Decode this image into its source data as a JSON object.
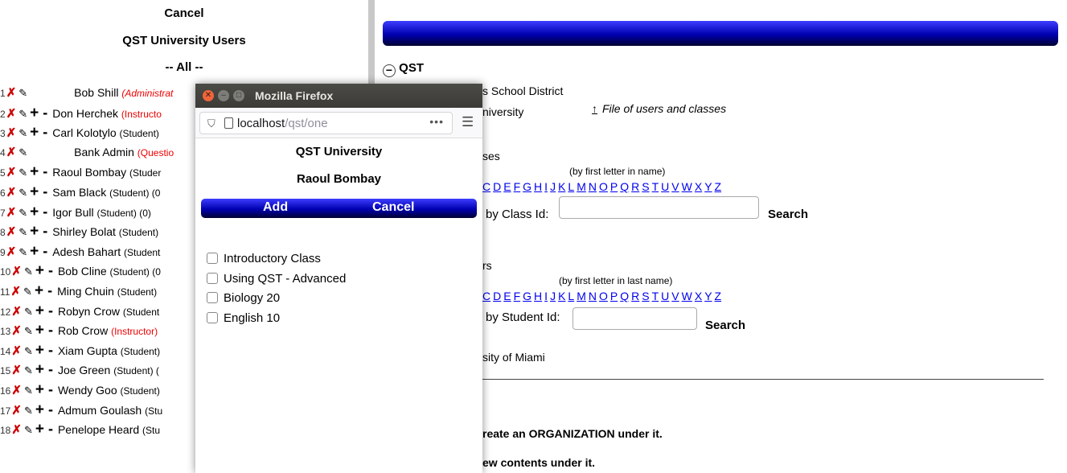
{
  "left": {
    "cancel": "Cancel",
    "title": "QST University Users",
    "filter": "-- All --",
    "users": [
      {
        "num": "1",
        "name": "Bob Shill",
        "role": "(Administrat",
        "role_style": "red",
        "actions": "xp"
      },
      {
        "num": "2",
        "name": "Don Herchek",
        "role": "(Instructo",
        "role_style": "redn",
        "actions": "xp+-"
      },
      {
        "num": "3",
        "name": "Carl Kolotylo",
        "role": "(Student)",
        "role_style": "",
        "actions": "xp+-"
      },
      {
        "num": "4",
        "name": "Bank Admin",
        "role": "(Questio",
        "role_style": "redn",
        "actions": "xp"
      },
      {
        "num": "5",
        "name": "Raoul Bombay",
        "role": "(Studer",
        "role_style": "",
        "actions": "xp+-"
      },
      {
        "num": "6",
        "name": "Sam Black",
        "role": "(Student) (0",
        "role_style": "",
        "actions": "xp+-"
      },
      {
        "num": "7",
        "name": "Igor Bull",
        "role": "(Student) (0)",
        "role_style": "",
        "actions": "xp+-"
      },
      {
        "num": "8",
        "name": "Shirley Bolat",
        "role": "(Student)",
        "role_style": "",
        "actions": "xp+-"
      },
      {
        "num": "9",
        "name": "Adesh Bahart",
        "role": "(Student",
        "role_style": "",
        "actions": "xp+-"
      },
      {
        "num": "10",
        "name": "Bob Cline",
        "role": "(Student) (0",
        "role_style": "",
        "actions": "xp+-"
      },
      {
        "num": "11",
        "name": "Ming Chuin",
        "role": "(Student)",
        "role_style": "",
        "actions": "xp+-"
      },
      {
        "num": "12",
        "name": "Robyn Crow",
        "role": "(Student",
        "role_style": "",
        "actions": "xp+-"
      },
      {
        "num": "13",
        "name": "Rob Crow",
        "role": "(Instructor)",
        "role_style": "redn",
        "actions": "xp+-"
      },
      {
        "num": "14",
        "name": "Xiam Gupta",
        "role": "(Student)",
        "role_style": "",
        "actions": "xp+-"
      },
      {
        "num": "15",
        "name": "Joe Green",
        "role": "(Student) (",
        "role_style": "",
        "actions": "xp+-"
      },
      {
        "num": "16",
        "name": "Wendy Goo",
        "role": "(Student)",
        "role_style": "",
        "actions": "xp+-"
      },
      {
        "num": "17",
        "name": "Admum Goulash",
        "role": "(Stu",
        "role_style": "",
        "actions": "xp+-"
      },
      {
        "num": "18",
        "name": "Penelope Heard",
        "role": "(Stu",
        "role_style": "",
        "actions": "xp+-"
      }
    ]
  },
  "right": {
    "org_root": "QST",
    "district": "s School District",
    "university": "niversity",
    "file_link": "File of users and classes",
    "classes_partial": "ses",
    "class_letter_hint": "(by first letter in name)",
    "class_letters": [
      "C",
      "D",
      "E",
      "F",
      "G",
      "H",
      "I",
      "J",
      "K",
      "L",
      "M",
      "N",
      "O",
      "P",
      "Q",
      "R",
      "S",
      "T",
      "U",
      "V",
      "W",
      "X",
      "Y",
      "Z"
    ],
    "class_id_label": "by Class Id:",
    "class_search": "Search",
    "users_partial": "rs",
    "user_letter_hint": "(by first letter in last name)",
    "user_letters": [
      "C",
      "D",
      "E",
      "F",
      "G",
      "H",
      "I",
      "J",
      "K",
      "L",
      "M",
      "N",
      "O",
      "P",
      "Q",
      "R",
      "S",
      "T",
      "U",
      "V",
      "W",
      "X",
      "Y",
      "Z"
    ],
    "student_id_label": "by Student Id:",
    "student_search": "Search",
    "miami": "sity of Miami",
    "create_org": "reate an ORGANIZATION under it.",
    "new_contents": "ew contents under it."
  },
  "popup": {
    "window_title": "Mozilla Firefox",
    "url_host": "localhost",
    "url_path": "/qst/one",
    "org": "QST University",
    "user": "Raoul Bombay",
    "add": "Add",
    "cancel": "Cancel",
    "classes": [
      "Introductory Class",
      "Using QST - Advanced",
      "Biology 20",
      "English 10"
    ]
  }
}
